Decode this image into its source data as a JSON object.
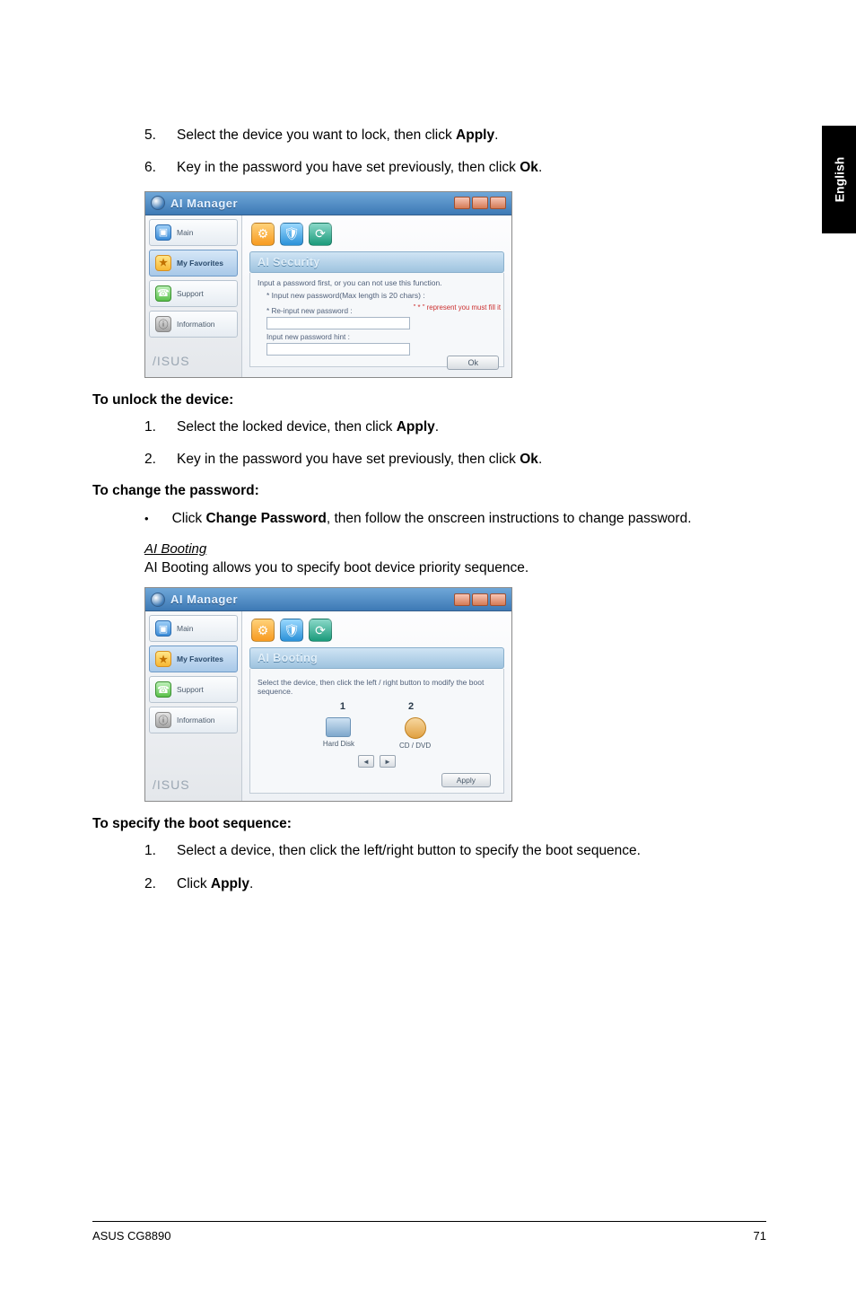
{
  "sideTab": "English",
  "steps_top": [
    {
      "n": "5.",
      "pre": "Select the device you want to lock, then click ",
      "bold": "Apply",
      "post": "."
    },
    {
      "n": "6.",
      "pre": "Key in the password you have set previously, then click ",
      "bold": "Ok",
      "post": "."
    }
  ],
  "window1": {
    "title": "AI Manager",
    "sidebar": [
      "Main",
      "My Favorites",
      "Support",
      "Information"
    ],
    "brand": "/ISUS",
    "panelTitle": "AI Security",
    "hint1": "Input a password first, or you can not use this function.",
    "hint2": "* Input new password(Max length is 20 chars) :",
    "label1": "* Re-input new password :",
    "label2": "Input new password hint :",
    "reqNote": "\" * \" represent you must fill it",
    "okLabel": "Ok"
  },
  "unlock_heading": "To unlock the device:",
  "unlock_steps": [
    {
      "n": "1.",
      "pre": "Select the locked device, then click ",
      "bold": "Apply",
      "post": "."
    },
    {
      "n": "2.",
      "pre": "Key in the password you have set previously, then click ",
      "bold": "Ok",
      "post": "."
    }
  ],
  "change_heading": "To change the password:",
  "change_bullet_pre": "Click ",
  "change_bullet_bold": "Change Password",
  "change_bullet_post": ", then follow the onscreen instructions to change password.",
  "ai_booting_title": "AI Booting",
  "ai_booting_desc": "AI Booting allows you to specify boot device priority sequence.",
  "window2": {
    "title": "AI Manager",
    "sidebar": [
      "Main",
      "My Favorites",
      "Support",
      "Information"
    ],
    "brand": "/ISUS",
    "panelTitle": "AI Booting",
    "desc": "Select the device, then click the left / right button to modify the boot sequence.",
    "col1": "1",
    "col2": "2",
    "dev1": "Hard Disk",
    "dev2": "CD / DVD",
    "applyLabel": "Apply"
  },
  "boot_heading": "To specify the boot sequence:",
  "boot_steps": [
    {
      "n": "1.",
      "pre": "Select a device, then click the left/right button to specify the boot sequence.",
      "bold": "",
      "post": ""
    },
    {
      "n": "2.",
      "pre": "Click ",
      "bold": "Apply",
      "post": "."
    }
  ],
  "footer_left": "ASUS CG8890",
  "footer_right": "71"
}
